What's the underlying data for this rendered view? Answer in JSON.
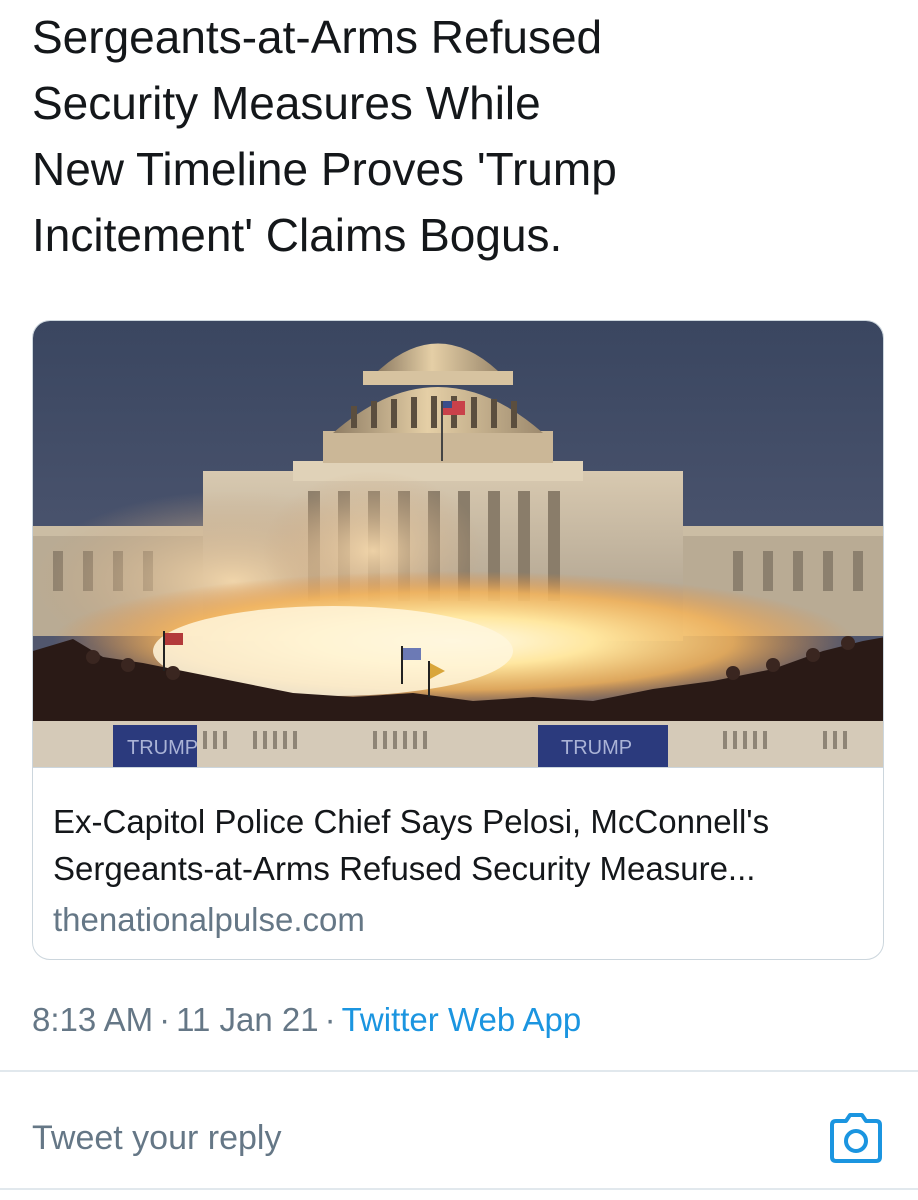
{
  "tweet": {
    "text": "Sergeants-at-Arms Refused\nSecurity Measures While\nNew Timeline Proves 'Trump\nIncitement' Claims Bogus."
  },
  "card": {
    "title": "Ex-Capitol Police Chief Says Pelosi, McConnell's Sergeants-at-Arms Refused Security Measure...",
    "domain": "thenationalpulse.com",
    "image_banner_text": "TRUMP"
  },
  "meta": {
    "time": "8:13 AM",
    "date": "11 Jan 21",
    "separator": "·",
    "source": "Twitter Web App"
  },
  "reply": {
    "placeholder": "Tweet your reply",
    "camera_icon": "camera-icon"
  },
  "colors": {
    "text": "#14171a",
    "secondary": "#657786",
    "accent": "#1b95e0",
    "border": "#ccd6dd"
  }
}
